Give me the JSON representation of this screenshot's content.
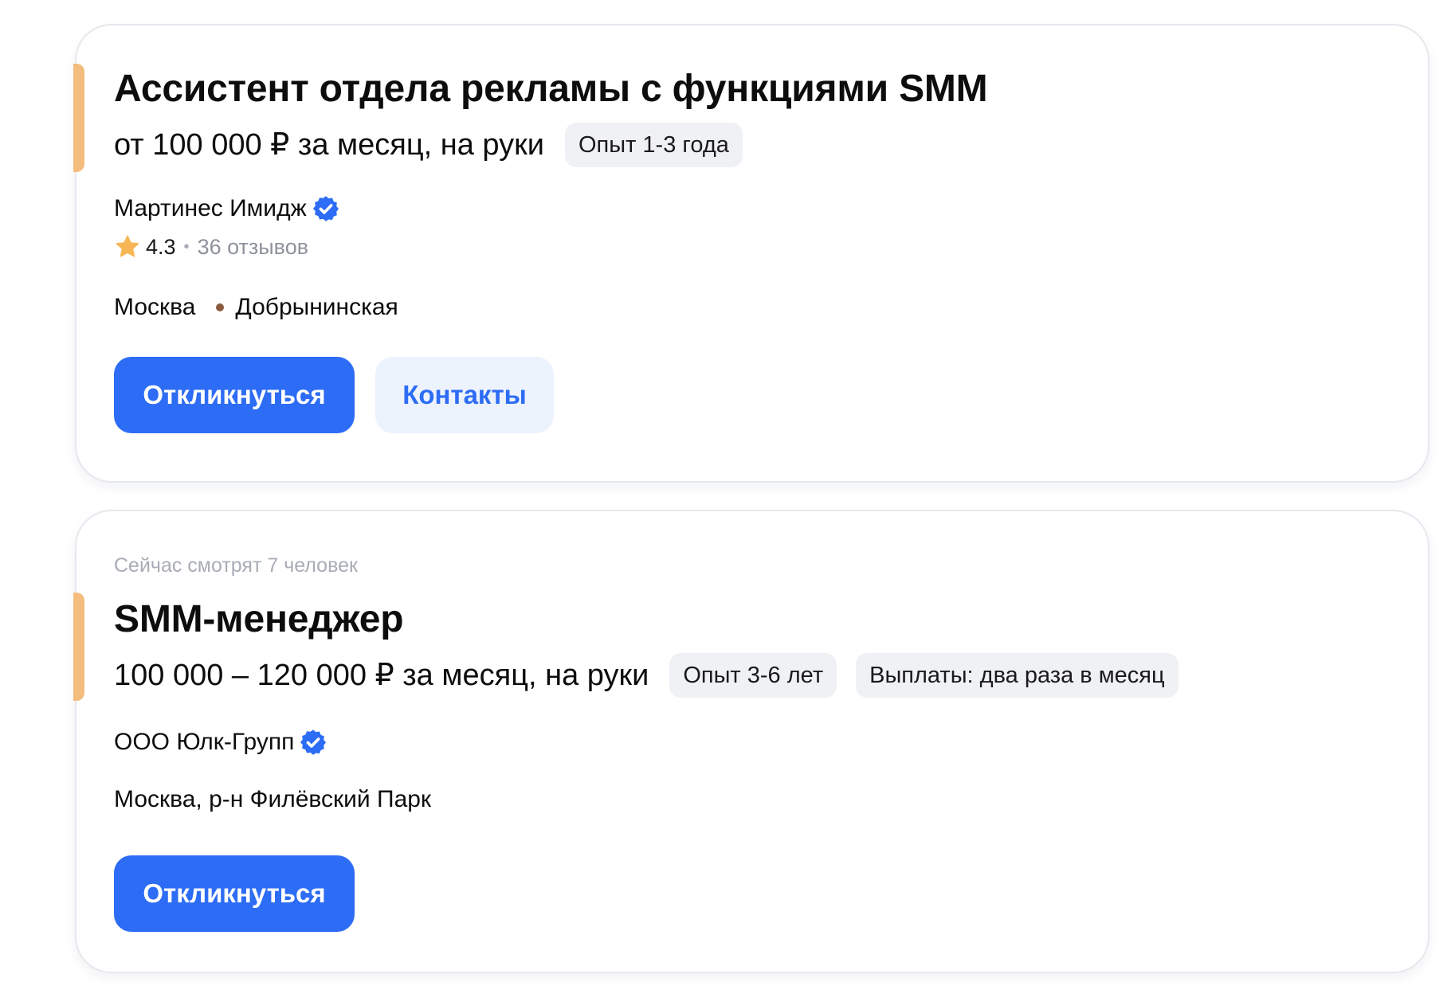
{
  "colors": {
    "accent_bar": "#f4bd7d",
    "primary": "#2d6cf5",
    "primary_text": "#ffffff",
    "secondary_bg": "#edf3fd",
    "secondary_text": "#2d6cf5",
    "chip_bg": "#eff1f5",
    "star": "#f7b655",
    "verified": "#2d6cf5",
    "metro_dot": "#8b5a3c"
  },
  "vacancies": [
    {
      "title": "Ассистент отдела рекламы с функциями SMM",
      "salary": "от 100 000 ₽ за месяц, на руки",
      "chips": [
        "Опыт 1-3 года"
      ],
      "employer": "Мартинес Имидж",
      "verified_icon": "verified-badge-icon",
      "rating": "4.3",
      "reviews": "36 отзывов",
      "city": "Москва",
      "metro": "Добрынинская",
      "buttons": {
        "respond": "Откликнуться",
        "contacts": "Контакты"
      }
    },
    {
      "viewers": "Сейчас смотрят 7 человек",
      "title": "SMM-менеджер",
      "salary": "100 000 – 120 000 ₽ за месяц, на руки",
      "chips": [
        "Опыт 3-6 лет",
        "Выплаты: два раза в месяц"
      ],
      "employer": "ООО Юлк-Групп",
      "verified_icon": "verified-badge-icon",
      "location": "Москва, р-н Филёвский Парк",
      "buttons": {
        "respond": "Откликнуться"
      }
    }
  ]
}
